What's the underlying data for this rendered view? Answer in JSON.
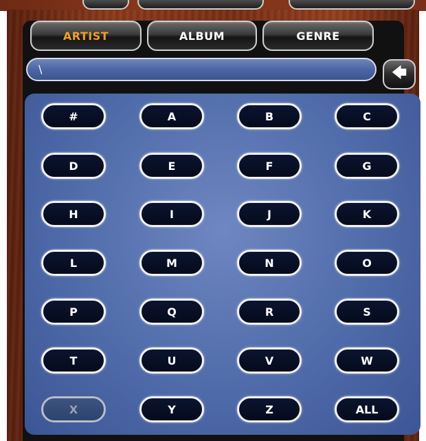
{
  "tabs": [
    {
      "label": "ARTIST",
      "active": true
    },
    {
      "label": "ALBUM",
      "active": false
    },
    {
      "label": "GENRE",
      "active": false
    }
  ],
  "search": {
    "value": "\\"
  },
  "backspace": {
    "icon": "left-arrow-icon",
    "glyph": "🡄"
  },
  "keys": [
    {
      "label": "#"
    },
    {
      "label": "A"
    },
    {
      "label": "B"
    },
    {
      "label": "C"
    },
    {
      "label": "D"
    },
    {
      "label": "E"
    },
    {
      "label": "F"
    },
    {
      "label": "G"
    },
    {
      "label": "H"
    },
    {
      "label": "I"
    },
    {
      "label": "J"
    },
    {
      "label": "K"
    },
    {
      "label": "L"
    },
    {
      "label": "M"
    },
    {
      "label": "N"
    },
    {
      "label": "O"
    },
    {
      "label": "P"
    },
    {
      "label": "Q"
    },
    {
      "label": "R"
    },
    {
      "label": "S"
    },
    {
      "label": "T"
    },
    {
      "label": "U"
    },
    {
      "label": "V"
    },
    {
      "label": "W"
    },
    {
      "label": "X",
      "disabled": true
    },
    {
      "label": "Y"
    },
    {
      "label": "Z"
    },
    {
      "label": "ALL"
    }
  ],
  "colors": {
    "active_tab": "#f2a016",
    "panel": "#5470ad",
    "wood": "#8b3a1b"
  }
}
